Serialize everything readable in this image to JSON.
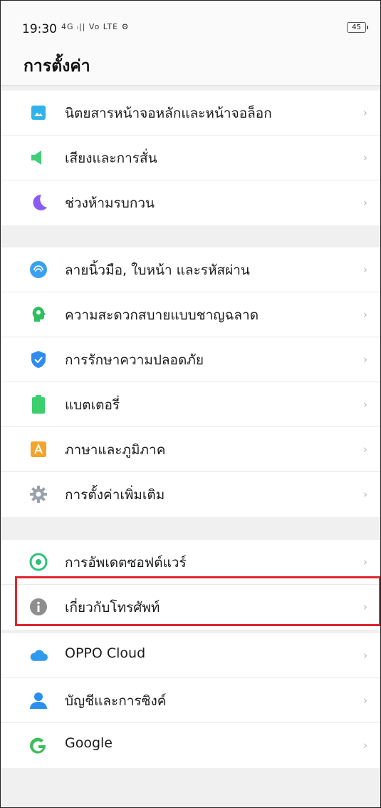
{
  "status_bar": {
    "time": "19:30",
    "signal": "4G ᵢ|| Vo LTE ⚙",
    "battery": "45"
  },
  "header": {
    "title": "การตั้งค่า"
  },
  "groups": [
    {
      "items": [
        {
          "label": "นิตยสารหน้าจอหลักและหน้าจอล็อก",
          "icon": "wallpaper-icon",
          "color": "#2fb3ea"
        },
        {
          "label": "เสียงและการสั่น",
          "icon": "speaker-icon",
          "color": "#3fcf77"
        },
        {
          "label": "ช่วงห้ามรบกวน",
          "icon": "moon-icon",
          "color": "#8b5cf5"
        }
      ]
    },
    {
      "items": [
        {
          "label": "ลายนิ้วมือ, ใบหน้า และรหัสผ่าน",
          "icon": "fingerprint-icon",
          "color": "#3aa0ef"
        },
        {
          "label": "ความสะดวกสบายแบบชาญฉลาด",
          "icon": "smart-assist-icon",
          "color": "#2fbf60"
        },
        {
          "label": "การรักษาความปลอดภัย",
          "icon": "shield-icon",
          "color": "#2e8cf0"
        },
        {
          "label": "แบตเตอรี่",
          "icon": "battery-icon",
          "color": "#3ccf6d"
        },
        {
          "label": "ภาษาและภูมิภาค",
          "icon": "language-icon",
          "color": "#f4a32c"
        },
        {
          "label": "การตั้งค่าเพิ่มเติม",
          "icon": "gear-icon",
          "color": "#9aa3ad"
        }
      ]
    },
    {
      "items": [
        {
          "label": "การอัพเดตซอฟต์แวร์",
          "icon": "update-icon",
          "color": "#2ec27a"
        },
        {
          "label": "เกี่ยวกับโทรศัพท์",
          "icon": "info-icon",
          "color": "#8e8e8e"
        }
      ]
    },
    {
      "items": [
        {
          "label": "OPPO Cloud",
          "icon": "cloud-icon",
          "color": "#2d9af0"
        },
        {
          "label": "บัญชีและการซิงค์",
          "icon": "account-icon",
          "color": "#2a8ff0"
        },
        {
          "label": "Google",
          "icon": "google-icon",
          "color": "#3cbf5a"
        }
      ]
    }
  ],
  "chevron": "›",
  "colors": {
    "highlight": "#e0262f"
  }
}
